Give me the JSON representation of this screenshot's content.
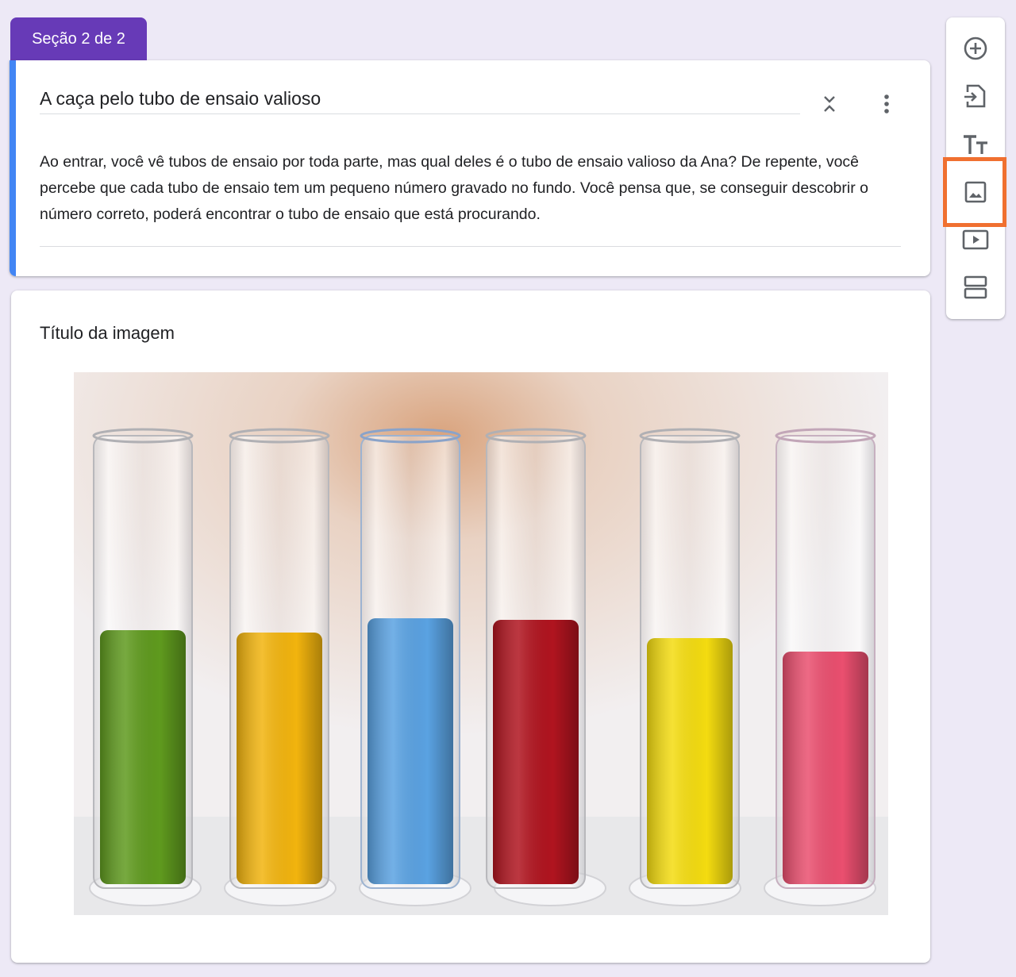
{
  "section": {
    "tab_label": "Seção 2 de 2",
    "title": "A caça pelo tubo de ensaio valioso",
    "description": "Ao entrar, você vê tubos de ensaio por toda parte, mas qual deles é o tubo de ensaio valioso da Ana? De repente, você percebe que cada tubo de ensaio tem um pequeno número gravado no fundo. Você pensa que, se conseguir descobrir o número correto, poderá encontrar o tubo de ensaio que está procurando."
  },
  "image_item": {
    "title": "Título da imagem",
    "image_subject": "six test tubes filled with green, yellow, blue, red, yellow and pink liquids"
  },
  "toolbar": {
    "tools": [
      {
        "icon": "add-circle-icon"
      },
      {
        "icon": "import-questions-icon"
      },
      {
        "icon": "title-text-icon"
      },
      {
        "icon": "add-image-icon",
        "highlighted": true
      },
      {
        "icon": "add-video-icon"
      },
      {
        "icon": "add-section-icon"
      }
    ],
    "highlight_color": "#f07030"
  },
  "colors": {
    "background": "#ede9f6",
    "accent_purple": "#673ab7",
    "accent_blue": "#4285f4"
  }
}
